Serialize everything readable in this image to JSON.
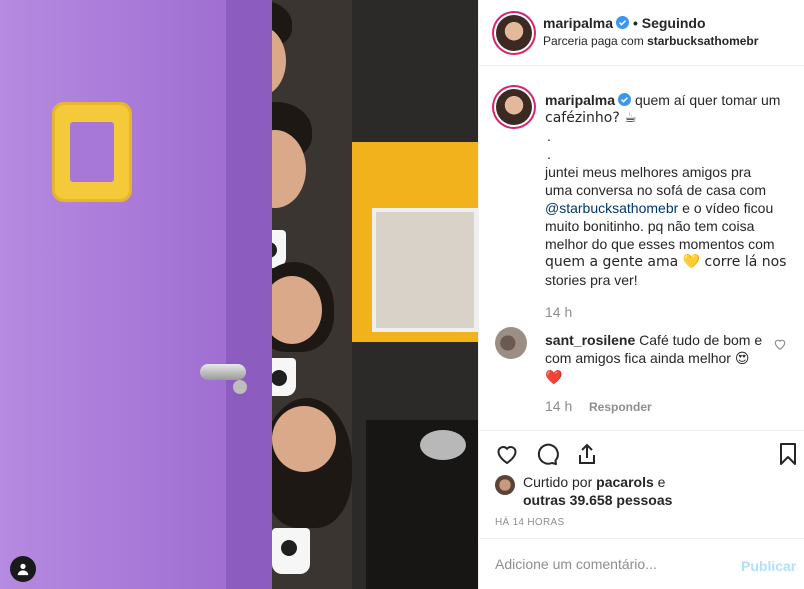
{
  "post_owner": {
    "username": "maripalma",
    "verified": true,
    "follow_separator": "•",
    "follow_status": "Seguindo",
    "partnership": "Parceria paga com",
    "partner": "starbucksathomebr"
  },
  "caption": {
    "username": "maripalma",
    "lines": [
      "quem aí quer tomar um",
      "cafézinho? ☕",
      ".",
      ".",
      "juntei meus melhores amigos pra",
      "uma conversa no sofá de casa com"
    ],
    "mention": "@starbucksathomebr",
    "after_mention": " e o vídeo ficou",
    "lines2": [
      "muito bonitinho. pq não tem coisa",
      "melhor do que esses momentos com",
      "quem a gente ama 💛 corre lá nos",
      "stories pra ver!"
    ],
    "time": "14 h"
  },
  "comment": {
    "username": "sant_rosilene",
    "text_line1": "Café tudo de bom",
    "text_line2": "e com amigos fica ainda melhor",
    "text_line3": "😍❤️",
    "time": "14 h",
    "reply_label": "Responder"
  },
  "actions": {
    "icons": [
      "heart-icon",
      "comment-icon",
      "share-icon",
      "bookmark-icon"
    ]
  },
  "likes": {
    "prefix": "Curtido por",
    "first_liker": "pacarols",
    "connector": "e",
    "others": "outras 39.658 pessoas"
  },
  "posted_ago": "HÁ 14 HORAS",
  "comment_box": {
    "placeholder": "Adicione um comentário...",
    "publish_label": "Publicar"
  },
  "colors": {
    "accent_link": "#00376b",
    "muted": "#8e8e8e",
    "publish_disabled": "#b2dffc",
    "door_purple": "#a878d8",
    "frame_yellow": "#f4c93a"
  }
}
